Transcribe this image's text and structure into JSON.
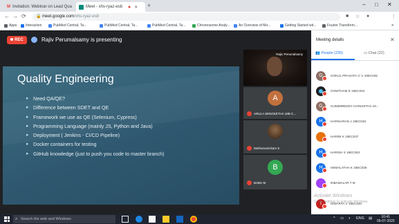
{
  "browser": {
    "tabs": [
      {
        "title": "Invitation: Webinar on Lead Qua",
        "favicon": "M",
        "favicon_color": "#ea4335"
      },
      {
        "title": "Meet - xhs-ryaz-esb",
        "favicon": "",
        "favicon_color": "#00897b"
      }
    ],
    "address": {
      "host": "meet.google.com",
      "path": "/xhs-ryaz-esb"
    },
    "bookmarks": [
      {
        "label": "Apps",
        "color": "#5f6368"
      },
      {
        "label": "Interaction",
        "color": "#1a73e8"
      },
      {
        "label": "PubMed Central, Ta...",
        "color": "#4285f4"
      },
      {
        "label": "PubMed Central, Ta...",
        "color": "#4285f4"
      },
      {
        "label": "PubMed Central, Ta...",
        "color": "#4285f4"
      },
      {
        "label": "Chromosome Analy...",
        "color": "#34a853"
      },
      {
        "label": "An Overview of Mo...",
        "color": "#4285f4"
      },
      {
        "label": "Getting Started wit...",
        "color": "#1a73e8"
      },
      {
        "label": "Fourier Transform...",
        "color": "#5f6368"
      }
    ]
  },
  "meet": {
    "rec_label": "REC",
    "presenting_text": "Rajiv Perumalsamy is presenting",
    "slide": {
      "title": "Quality Engineering",
      "bullets": [
        "Need QA/QE?",
        "Difference between SDET and QE",
        "Framework we use as QE (Selenium, Cypress)",
        "Programming Language (mainly JS, Python and Java)",
        "Deployment ( Jenkins - CI/CD Pipeline)",
        "Docker containers for testing",
        "GitHub knowledge (just to push you code to master branch)"
      ]
    },
    "tiles": [
      {
        "name": "Rajiv Perumalsamy",
        "type": "video"
      },
      {
        "name": "ARULA SENGEETHA 18B C...",
        "letter": "A",
        "color": "#c2703d"
      },
      {
        "name": "Muthumanickam S",
        "type": "photo"
      },
      {
        "name": "BABU M",
        "letter": "B",
        "color": "#34a853"
      }
    ]
  },
  "panel": {
    "title": "Meeting details",
    "people_tab": "People (230)",
    "chat_tab": "Chat (22)",
    "participants": [
      {
        "name": "GOKUL PRASATH C V 19EC045",
        "letter": "G",
        "color": "#8d6e63"
      },
      {
        "name": "GOWTHAM E 19EC034",
        "letter": "",
        "color": "#202124"
      },
      {
        "name": "GUMMIREDDY HARSHITHA 19...",
        "letter": "G",
        "color": "#8d6e63"
      },
      {
        "name": "HARIHARAN J 19EC046",
        "letter": "H",
        "color": "#1a73e8"
      },
      {
        "name": "HARINI K 19EC037",
        "letter": "",
        "color": "#e8710a"
      },
      {
        "name": "HARISH S 19EC063",
        "letter": "H",
        "color": "#1a73e8"
      },
      {
        "name": "HEMALATHA K 19EC039",
        "letter": "H",
        "color": "#1a73e8"
      },
      {
        "name": "INBAMALAR T M",
        "letter": "",
        "color": "#a142f4"
      },
      {
        "name": "ISWARYA V 19EC040",
        "letter": "I",
        "color": "#c5221f"
      }
    ],
    "watermark": {
      "line1": "Activate Windows",
      "line2": "Go to Settings to activate Windows."
    }
  },
  "taskbar": {
    "search_placeholder": "Search the web and Windows",
    "clock_time": "10:41",
    "clock_date": "06-07-2020",
    "lang": "ENG"
  }
}
